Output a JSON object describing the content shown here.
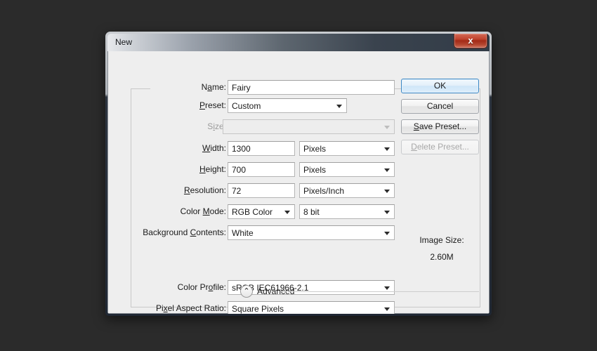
{
  "desktop": {
    "background_color": "#2b2b2b"
  },
  "window": {
    "title": "New",
    "close_icon": "close-icon",
    "close_glyph": "x",
    "close_color": "#b54630"
  },
  "form": {
    "name": {
      "label_pre": "N",
      "label_acc": "a",
      "label_post": "me:",
      "value": "Fairy",
      "placeholder": ""
    },
    "preset": {
      "label_pre": "",
      "label_acc": "P",
      "label_post": "reset:",
      "value": "Custom"
    },
    "size": {
      "label_pre": "S",
      "label_acc": "i",
      "label_post": "ze:",
      "value": "",
      "disabled": true
    },
    "width": {
      "label_pre": "",
      "label_acc": "W",
      "label_post": "idth:",
      "value": "1300",
      "unit": "Pixels"
    },
    "height": {
      "label_pre": "",
      "label_acc": "H",
      "label_post": "eight:",
      "value": "700",
      "unit": "Pixels"
    },
    "resolution": {
      "label_pre": "",
      "label_acc": "R",
      "label_post": "esolution:",
      "value": "72",
      "unit": "Pixels/Inch"
    },
    "color_mode": {
      "label_pre": "Color ",
      "label_acc": "M",
      "label_post": "ode:",
      "value": "RGB Color",
      "depth": "8 bit"
    },
    "background_contents": {
      "label_pre": "Background ",
      "label_acc": "C",
      "label_post": "ontents:",
      "value": "White"
    },
    "advanced": {
      "label": "Advanced",
      "toggle_icon": "chevron-up-icon",
      "toggle_glyph": "⌃",
      "expanded": true
    },
    "color_profile": {
      "label_pre": "Color Pr",
      "label_acc": "o",
      "label_post": "file:",
      "value": "sRGB IEC61966-2.1"
    },
    "pixel_aspect_ratio": {
      "label_pre": "Pi",
      "label_acc": "x",
      "label_post": "el Aspect Ratio:",
      "value": "Square Pixels"
    }
  },
  "buttons": {
    "ok": {
      "label": "OK",
      "default": true
    },
    "cancel": {
      "label": "Cancel"
    },
    "save_preset": {
      "label_pre": "",
      "label_acc": "S",
      "label_post": "ave Preset..."
    },
    "delete_preset": {
      "label_pre": "",
      "label_acc": "D",
      "label_post": "elete Preset...",
      "disabled": true
    }
  },
  "image_size": {
    "label": "Image Size:",
    "value": "2.60M"
  }
}
